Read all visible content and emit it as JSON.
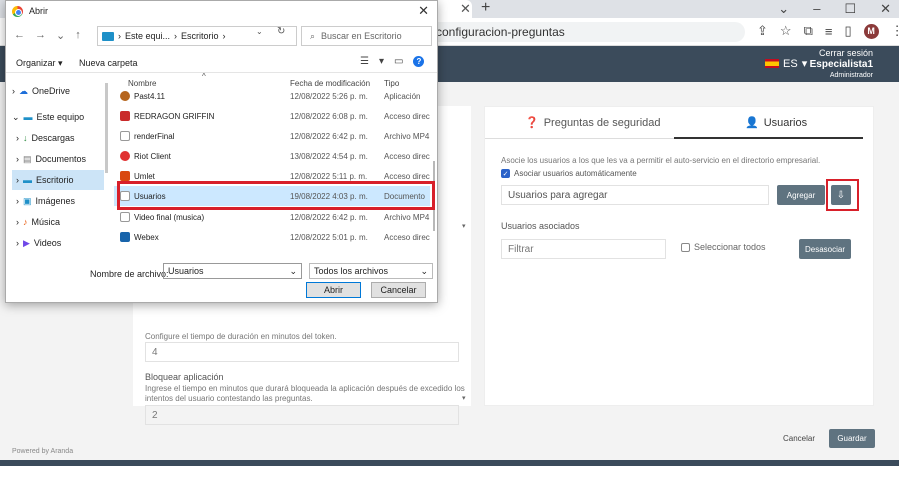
{
  "browser": {
    "url": "configuracion-preguntas",
    "new_tab": "+",
    "tab_close": "✕",
    "avatar_letter": "M"
  },
  "header": {
    "language": "ES",
    "logout": "Cerrar sesión",
    "user_name": "Especialista1",
    "user_role": "Administrador",
    "bg_color": "#3b4b5b"
  },
  "left_panel": {
    "token_desc": "Configure el tiempo de duración en minutos del token.",
    "token_value": "4",
    "block_label": "Bloquear aplicación",
    "block_desc": "Ingrese el tiempo en minutos que durará bloqueada la aplicación después de excedido los intentos del usuario contestando las preguntas.",
    "block_value": "2"
  },
  "right_panel": {
    "tabs": [
      {
        "label": "Preguntas de seguridad",
        "icon": "question-circle-icon"
      },
      {
        "label": "Usuarios",
        "icon": "user-icon"
      }
    ],
    "desc": "Asocie los usuarios a los que les va a permitir el auto-servicio en el directorio empresarial.",
    "auto_assoc_label": "Asociar usuarios automáticamente",
    "add_placeholder": "Usuarios para agregar",
    "add_button": "Agregar",
    "associated_label": "Usuarios asociados",
    "filter_placeholder": "Filtrar",
    "select_all_label": "Seleccionar todos",
    "dissociate_button": "Desasociar"
  },
  "footer": {
    "cancel": "Cancelar",
    "save": "Guardar",
    "powered_by": "Powered by Aranda"
  },
  "dialog": {
    "title": "Abrir",
    "path": [
      "Este equi...",
      "Escritorio"
    ],
    "search_placeholder": "Buscar en Escritorio",
    "organize": "Organizar",
    "new_folder": "Nueva carpeta",
    "nav_items": [
      {
        "label": "OneDrive",
        "icon": "cloud-icon"
      },
      {
        "label": "Este equipo",
        "icon": "computer-icon"
      },
      {
        "label": "Descargas",
        "icon": "download-icon"
      },
      {
        "label": "Documentos",
        "icon": "document-icon"
      },
      {
        "label": "Escritorio",
        "icon": "desktop-icon"
      },
      {
        "label": "Imágenes",
        "icon": "image-icon"
      },
      {
        "label": "Música",
        "icon": "music-icon"
      },
      {
        "label": "Videos",
        "icon": "video-icon"
      }
    ],
    "columns": {
      "name": "Nombre",
      "date": "Fecha de modificación",
      "type": "Tipo"
    },
    "files": [
      {
        "name": "Past4.11",
        "date": "12/08/2022 5:26 p. m.",
        "type": "Aplicación"
      },
      {
        "name": "REDRAGON GRIFFIN",
        "date": "12/08/2022 6:08 p. m.",
        "type": "Acceso direc"
      },
      {
        "name": "renderFinal",
        "date": "12/08/2022 6:42 p. m.",
        "type": "Archivo MP4"
      },
      {
        "name": "Riot Client",
        "date": "13/08/2022 4:54 p. m.",
        "type": "Acceso direc"
      },
      {
        "name": "Umlet",
        "date": "12/08/2022 5:11 p. m.",
        "type": "Acceso direc"
      },
      {
        "name": "Usuarios",
        "date": "19/08/2022 4:03 p. m.",
        "type": "Documento"
      },
      {
        "name": "Video final (musica)",
        "date": "12/08/2022 6:42 p. m.",
        "type": "Archivo MP4"
      },
      {
        "name": "Webex",
        "date": "12/08/2022 5:01 p. m.",
        "type": "Acceso direc"
      }
    ],
    "filename_label": "Nombre de archivo:",
    "filename_value": "Usuarios",
    "filetype_value": "Todos los archivos",
    "open_button": "Abrir",
    "cancel_button": "Cancelar"
  },
  "colors": {
    "accent_button": "#5f7380",
    "highlight_box": "#d8202a",
    "selection": "#cce8ff"
  }
}
